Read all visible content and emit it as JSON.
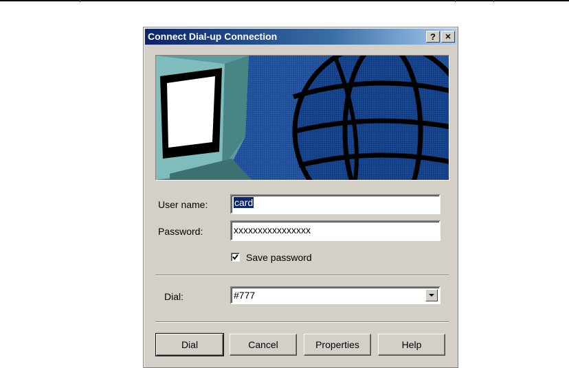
{
  "window": {
    "title": "Connect Dial-up Connection",
    "help_glyph": "?",
    "close_glyph": "✕"
  },
  "form": {
    "username_label": "User name:",
    "username_value": "card",
    "password_label": "Password:",
    "password_value": "xxxxxxxxxxxxxxxx",
    "save_password_label": "Save password",
    "save_password_checked": true,
    "dial_label": "Dial:",
    "dial_value": "#777"
  },
  "buttons": {
    "dial": "Dial",
    "cancel": "Cancel",
    "properties": "Properties",
    "help": "Help"
  },
  "icons": [
    "help-icon",
    "close-icon",
    "checkmark-icon",
    "dropdown-arrow-icon",
    "monitor-graphic",
    "globe-graphic"
  ],
  "colors": {
    "titlebar_start": "#0a246a",
    "titlebar_end": "#a6caf0",
    "banner_bg": "#1f4f98",
    "monitor_teal": "#5e9c9c"
  }
}
